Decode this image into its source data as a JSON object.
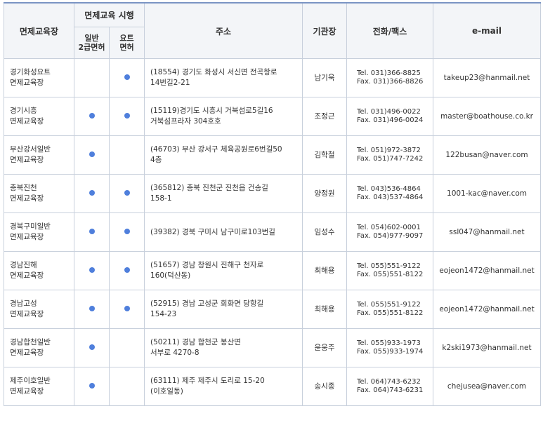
{
  "headers": {
    "center": "면제교육장",
    "exec_group": "면제교육 시행",
    "general_1": "일반",
    "general_2": "2급면허",
    "yacht_1": "요트",
    "yacht_2": "면허",
    "address": "주소",
    "director": "기관장",
    "phone": "전화/팩스",
    "email": "e-mail"
  },
  "rows": [
    {
      "name1": "경기화성요트",
      "name2": "면제교육장",
      "general": false,
      "yacht": true,
      "addr1": "(18554) 경기도 화성시 서신면 전곡항로",
      "addr2": "14번길2-21",
      "director": "남기욱",
      "tel": "Tel. 031)366-8825",
      "fax": "Fax. 031)366-8826",
      "email": "takeup23@hanmail.net"
    },
    {
      "name1": "경기시흥",
      "name2": "면제교육장",
      "general": true,
      "yacht": true,
      "addr1": "(15119)경기도 시흥시 거북섬로5길16",
      "addr2": "거북섬프라자 304호호",
      "director": "조정근",
      "tel": "Tel. 031)496-0022",
      "fax": "Fax. 031)496-0024",
      "email": "master@boathouse.co.kr"
    },
    {
      "name1": "부산강서일반",
      "name2": "면제교육장",
      "general": true,
      "yacht": false,
      "addr1": "(46703) 부산 강서구 체육공원로6번길50",
      "addr2": "4층",
      "director": "김학철",
      "tel": "Tel. 051)972-3872",
      "fax": "Fax. 051)747-7242",
      "email": "122busan@naver.com"
    },
    {
      "name1": "충북진천",
      "name2": "면제교육장",
      "general": true,
      "yacht": true,
      "addr1": "(365812) 충북 진천군 진천읍 건송길",
      "addr2": "158-1",
      "director": "양정원",
      "tel": "Tel. 043)536-4864",
      "fax": "Fax. 043)537-4864",
      "email": "1001-kac@naver.com"
    },
    {
      "name1": "경북구미일반",
      "name2": "면제교육장",
      "general": true,
      "yacht": true,
      "addr1": "(39382) 경북 구미시 남구미로103번길",
      "addr2": "",
      "director": "임성수",
      "tel": "Tel. 054)602-0001",
      "fax": "Fax. 054)977-9097",
      "email": "ssl047@hanmail.net"
    },
    {
      "name1": "경남진해",
      "name2": "면제교육장",
      "general": true,
      "yacht": true,
      "addr1": "(51657) 경남 창원시 진해구 천자로",
      "addr2": "160(덕산동)",
      "director": "최해용",
      "tel": "Tel. 055)551-9122",
      "fax": "Fax. 055)551-8122",
      "email": "eojeon1472@hanmail.net"
    },
    {
      "name1": "경남고성",
      "name2": "면제교육장",
      "general": true,
      "yacht": true,
      "addr1": "(52915) 경남 고성군 회화면 당항길",
      "addr2": "154-23",
      "director": "최해용",
      "tel": "Tel. 055)551-9122",
      "fax": "Fax. 055)551-8122",
      "email": "eojeon1472@hanmail.net"
    },
    {
      "name1": "경남합천일반",
      "name2": "면제교육장",
      "general": true,
      "yacht": false,
      "addr1": "(50211) 경남 합천군 봉산면",
      "addr2": "서부로 4270-8",
      "director": "윤웅주",
      "tel": "Tel. 055)933-1973",
      "fax": "Fax. 055)933-1974",
      "email": "k2ski1973@hanmail.net"
    },
    {
      "name1": "제주이호일반",
      "name2": "면제교육장",
      "general": true,
      "yacht": false,
      "addr1": "(63111) 제주 제주시 도리로 15-20",
      "addr2": "(이호일동)",
      "director": "송시종",
      "tel": "Tel. 064)743-6232",
      "fax": "Fax. 064)743-6231",
      "email": "chejusea@naver.com"
    }
  ]
}
